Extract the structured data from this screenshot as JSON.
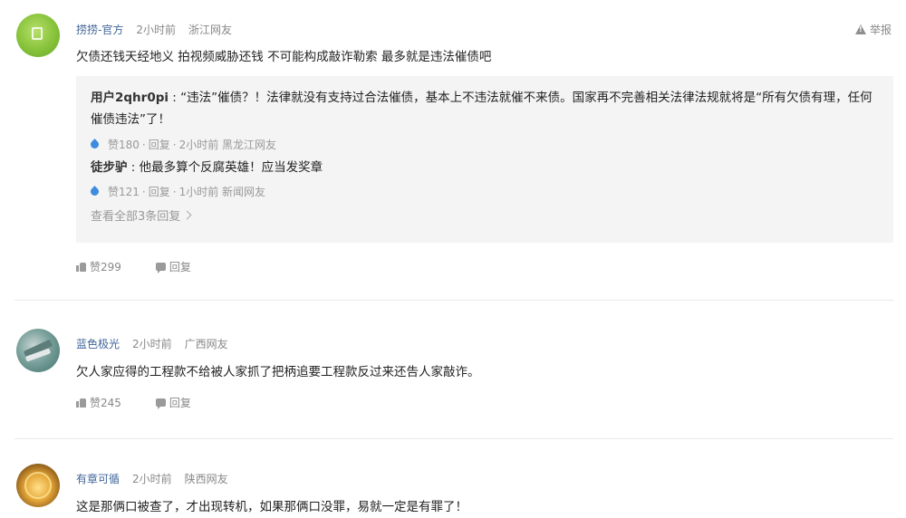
{
  "comments": [
    {
      "username": "捞捞-官方",
      "time": "2小时前",
      "location": "浙江网友",
      "text": "欠债还钱天经地义 拍视频威胁还钱 不可能构成敲诈勒索 最多就是违法催债吧",
      "report_label": "举报",
      "replies": [
        {
          "user": "用户2qhr0pi",
          "text": "“违法”催债？！法律就没有支持过合法催债，基本上不违法就催不来债。国家再不完善相关法律法规就将是“所有欠债有理，任何催债违法”了！",
          "likes": "赞180",
          "reply_label": "回复",
          "time": "2小时前",
          "location": "黑龙江网友"
        },
        {
          "user": "徒步驴",
          "text": "他最多算个反腐英雄！应当发奖章",
          "likes": "赞121",
          "reply_label": "回复",
          "time": "1小时前",
          "location": "新闻网友"
        }
      ],
      "view_all": "查看全部3条回复",
      "like_label": "赞299",
      "reply_label": "回复"
    },
    {
      "username": "蓝色极光",
      "time": "2小时前",
      "location": "广西网友",
      "text": "欠人家应得的工程款不给被人家抓了把柄追要工程款反过来还告人家敲诈。",
      "like_label": "赞245",
      "reply_label": "回复"
    },
    {
      "username": "有章可循",
      "time": "2小时前",
      "location": "陕西网友",
      "text": "这是那俩口被查了，才出现转机，如果那俩口没罪，易就一定是有罪了！"
    }
  ],
  "colors": {
    "username": "#406599",
    "reply_box_bg": "#f4f4f4",
    "like_drop": "#3d8ce0"
  },
  "icons": [
    "warning-icon",
    "like-drop-icon",
    "thumb-up-icon",
    "comment-bubble-icon",
    "chevron-right-icon"
  ]
}
